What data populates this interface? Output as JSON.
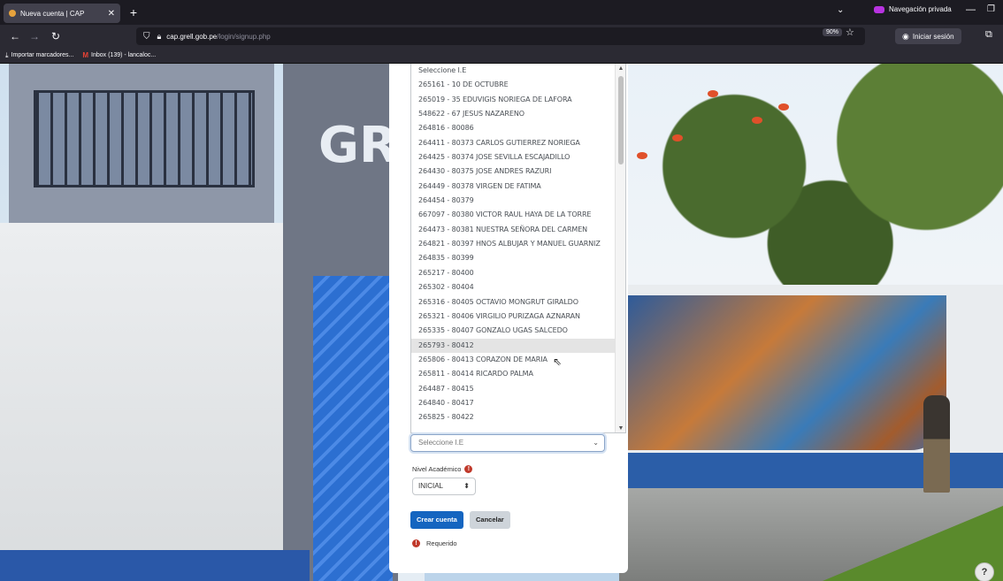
{
  "browser": {
    "tab_title": "Nueva cuenta | CAP",
    "new_tab": "+",
    "private_label": "Navegación privada",
    "url_domain": "cap.grell.gob.pe",
    "url_path": "/login/signup.php",
    "zoom": "90%",
    "signin_label": "Iniciar sesión",
    "bookmarks": [
      {
        "label": "Importar marcadores..."
      },
      {
        "label": "Inbox (139) - lancaloc..."
      }
    ]
  },
  "background": {
    "building_letters": "GR"
  },
  "form": {
    "dropdown_options": [
      "Seleccione I.E",
      "265161 - 10 DE OCTUBRE",
      "265019 - 35 EDUVIGIS NORIEGA DE LAFORA",
      "548622 - 67 JESUS NAZARENO",
      "264816 - 80086",
      "264411 - 80373 CARLOS GUTIERREZ NORIEGA",
      "264425 - 80374 JOSE SEVILLA ESCAJADILLO",
      "264430 - 80375 JOSE ANDRES RAZURI",
      "264449 - 80378 VIRGEN DE FATIMA",
      "264454 - 80379",
      "667097 - 80380 VICTOR RAUL HAYA DE LA TORRE",
      "264473 - 80381 NUESTRA SEÑORA DEL CARMEN",
      "264821 - 80397 HNOS ALBUJAR Y MANUEL GUARNIZ",
      "264835 - 80399",
      "265217 - 80400",
      "265302 - 80404",
      "265316 - 80405 OCTAVIO MONGRUT GIRALDO",
      "265321 - 80406 VIRGILIO PURIZAGA AZNARAN",
      "265335 - 80407 GONZALO UGAS SALCEDO",
      "265793 - 80412",
      "265806 - 80413 CORAZON DE MARIA",
      "265811 - 80414 RICARDO PALMA",
      "264487 - 80415",
      "264840 - 80417",
      "265825 - 80422"
    ],
    "highlighted_index": 19,
    "ie_select_value": "Seleccione I.E",
    "nivel_label": "Nivel Académico",
    "nivel_value": "INICIAL",
    "create_button": "Crear cuenta",
    "cancel_button": "Cancelar",
    "required_label": "Requerido"
  },
  "help_label": "?"
}
